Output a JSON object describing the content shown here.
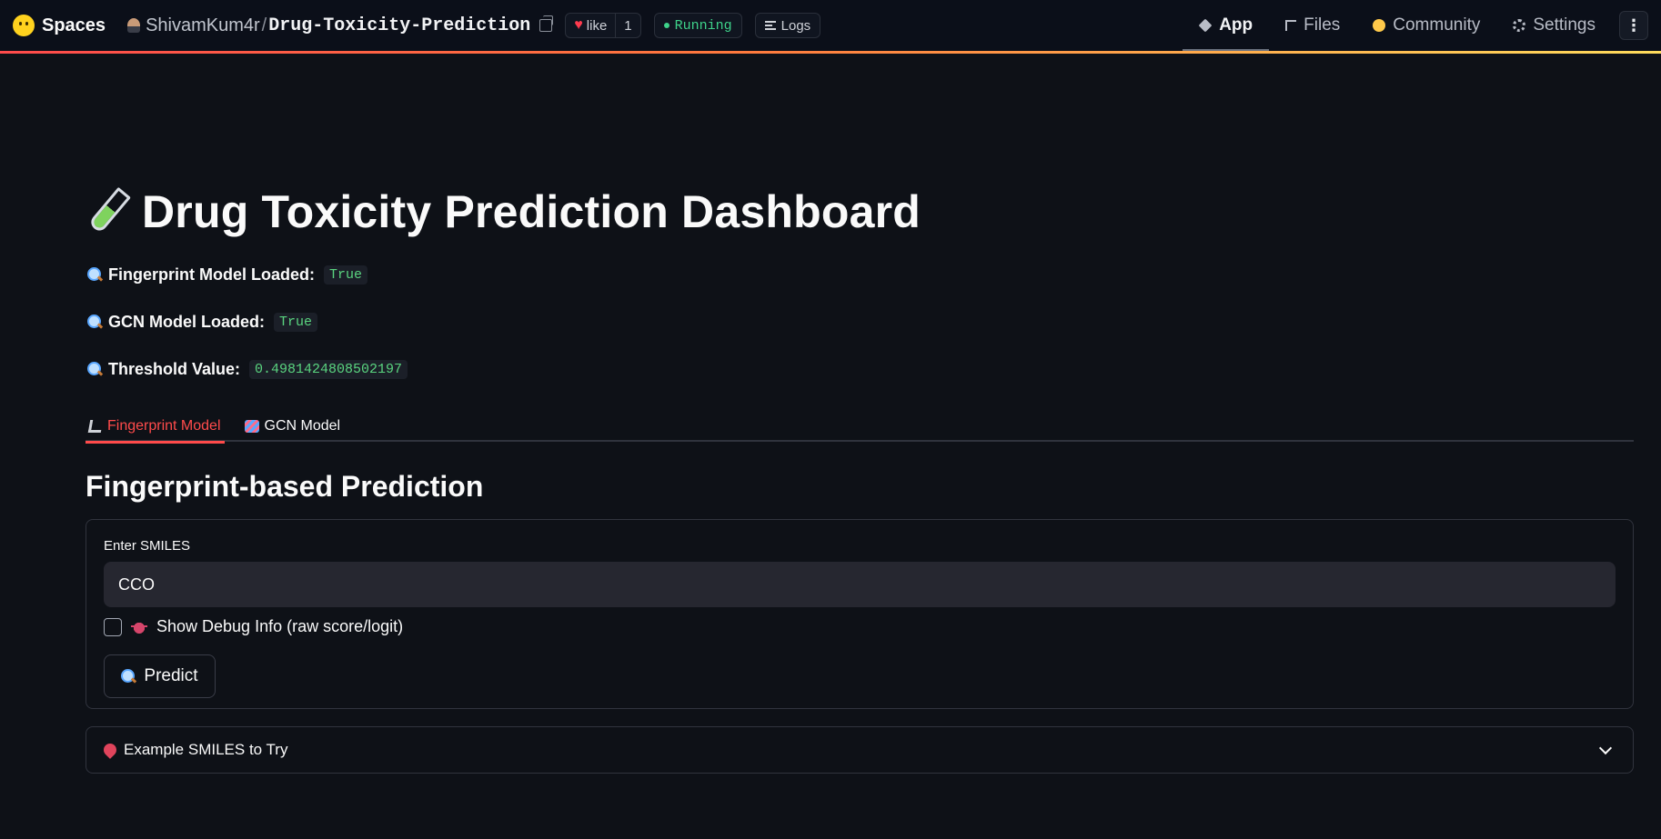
{
  "topbar": {
    "brand": "Spaces",
    "owner": "ShivamKum4r",
    "separator": "/",
    "repo": "Drug-Toxicity-Prediction",
    "like_label": "like",
    "like_count": "1",
    "status": "Running",
    "logs": "Logs",
    "nav": [
      {
        "label": "App",
        "icon": "cube-icon",
        "active": true
      },
      {
        "label": "Files",
        "icon": "files-icon",
        "active": false
      },
      {
        "label": "Community",
        "icon": "community-icon",
        "active": false
      },
      {
        "label": "Settings",
        "icon": "gear-icon",
        "active": false
      }
    ],
    "more": "⋮"
  },
  "page": {
    "title": "Drug Toxicity Prediction Dashboard",
    "status": [
      {
        "label": "Fingerprint Model Loaded:",
        "value": "True"
      },
      {
        "label": "GCN Model Loaded:",
        "value": "True"
      },
      {
        "label": "Threshold Value:",
        "value": "0.4981424808502197"
      }
    ],
    "tabs": [
      {
        "label": "Fingerprint Model",
        "active": true
      },
      {
        "label": "GCN Model",
        "active": false
      }
    ],
    "section_title": "Fingerprint-based Prediction",
    "form": {
      "input_label": "Enter SMILES",
      "input_value": "CCO",
      "checkbox_label": "Show Debug Info (raw score/logit)",
      "checkbox_checked": false,
      "predict_label": "Predict"
    },
    "expander_label": "Example SMILES to Try"
  },
  "colors": {
    "accent": "#ff4b4b",
    "background": "#0e1117",
    "code_text": "#5ad47f",
    "running": "#3ed28a"
  }
}
